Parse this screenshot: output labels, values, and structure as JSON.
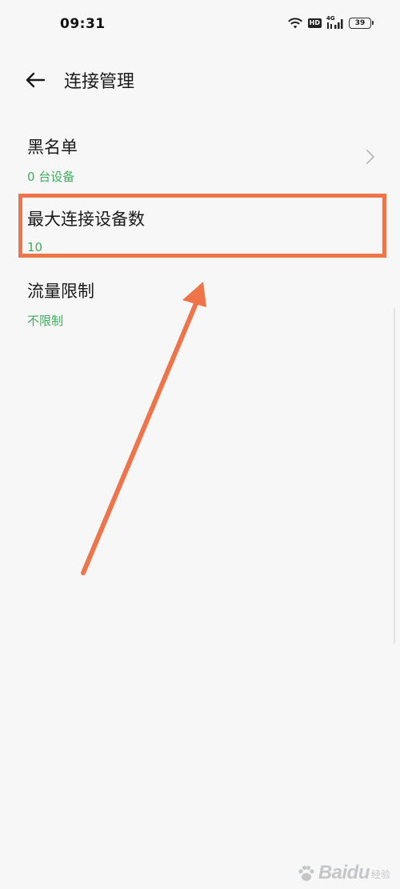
{
  "status_bar": {
    "time": "09:31",
    "hd_label": "HD",
    "network_label": "4G",
    "battery_level": "39",
    "icons": [
      "wifi-icon",
      "hd-icon",
      "signal-4g-icon",
      "battery-icon"
    ]
  },
  "header": {
    "title": "连接管理",
    "back_icon": "back-arrow-icon"
  },
  "list": {
    "items": [
      {
        "title": "黑名单",
        "subtitle": "0 台设备",
        "has_chevron": true
      },
      {
        "title": "最大连接设备数",
        "subtitle": "10",
        "highlighted": true
      },
      {
        "title": "流量限制",
        "subtitle": "不限制"
      }
    ]
  },
  "annotation": {
    "highlight_color": "#f0744a",
    "arrow_color": "#f0744a"
  },
  "colors": {
    "background": "#f7f7f7",
    "subtitle_green": "#3dae5e",
    "text_primary": "#1a1a1a"
  },
  "watermark": {
    "text": "Baidu",
    "sub": "经验",
    "logo_icon": "paw-icon"
  }
}
